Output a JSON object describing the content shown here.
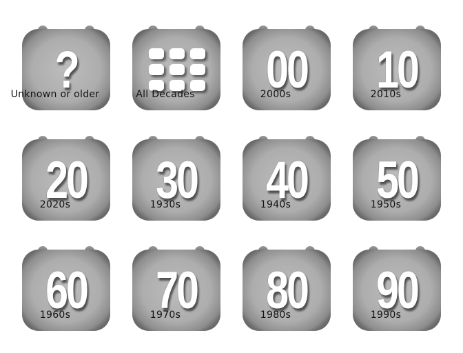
{
  "tiles": [
    {
      "glyph": "?",
      "label": "Unknown or older",
      "icon": "question-mark-icon"
    },
    {
      "glyph": "",
      "label": "All Decades",
      "icon": "grid-icon"
    },
    {
      "glyph": "00",
      "label": "2000s",
      "icon": "calendar-00-icon"
    },
    {
      "glyph": "10",
      "label": "2010s",
      "icon": "calendar-10-icon"
    },
    {
      "glyph": "20",
      "label": "2020s",
      "icon": "calendar-20-icon"
    },
    {
      "glyph": "30",
      "label": "1930s",
      "icon": "calendar-30-icon"
    },
    {
      "glyph": "40",
      "label": "1940s",
      "icon": "calendar-40-icon"
    },
    {
      "glyph": "50",
      "label": "1950s",
      "icon": "calendar-50-icon"
    },
    {
      "glyph": "60",
      "label": "1960s",
      "icon": "calendar-60-icon"
    },
    {
      "glyph": "70",
      "label": "1970s",
      "icon": "calendar-70-icon"
    },
    {
      "glyph": "80",
      "label": "1980s",
      "icon": "calendar-80-icon"
    },
    {
      "glyph": "90",
      "label": "1990s",
      "icon": "calendar-90-icon"
    }
  ]
}
